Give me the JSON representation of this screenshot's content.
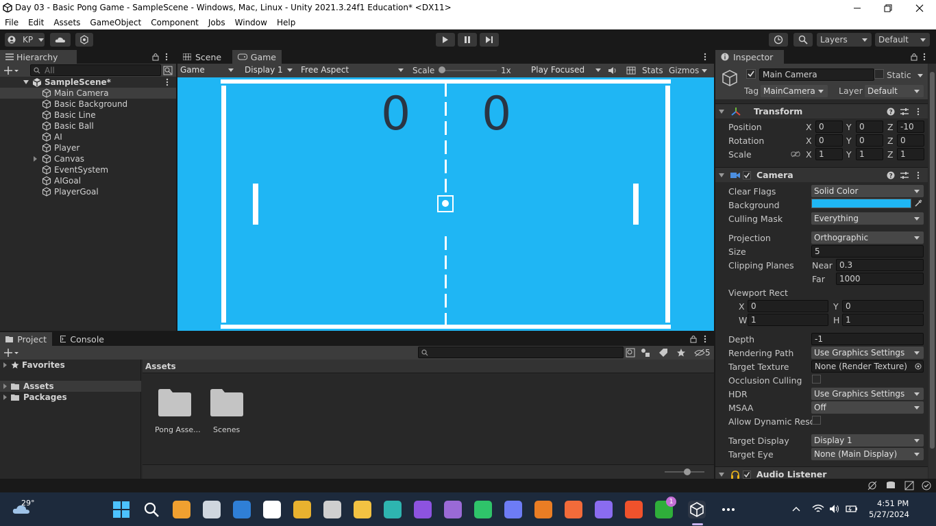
{
  "window": {
    "title": "Day 03 - Basic Pong Game - SampleScene - Windows, Mac, Linux - Unity 2021.3.24f1 Education* <DX11>"
  },
  "menu": [
    "File",
    "Edit",
    "Assets",
    "GameObject",
    "Component",
    "Jobs",
    "Window",
    "Help"
  ],
  "toolbar": {
    "account": "KP",
    "layers": "Layers",
    "layout": "Default"
  },
  "hierarchy": {
    "tab": "Hierarchy",
    "search_placeholder": "All",
    "scene": "SampleScene*",
    "items": [
      "Main Camera",
      "Basic Background",
      "Basic Line",
      "Basic Ball",
      "AI",
      "Player",
      "Canvas",
      "EventSystem",
      "AIGoal",
      "PlayerGoal"
    ]
  },
  "center": {
    "tabs": [
      "Scene",
      "Game"
    ],
    "game_toolbar": {
      "mode": "Game",
      "display": "Display 1",
      "aspect": "Free Aspect",
      "scale_label": "Scale",
      "scale_value": "1x",
      "play_focused": "Play Focused",
      "stats": "Stats",
      "gizmos": "Gizmos"
    },
    "scores": {
      "left": "0",
      "right": "0"
    }
  },
  "project": {
    "tabs": [
      "Project",
      "Console"
    ],
    "tree": [
      "Favorites",
      "Assets",
      "Packages"
    ],
    "breadcrumb": "Assets",
    "folders": [
      "Pong Asse...",
      "Scenes"
    ],
    "hidden_count": "5"
  },
  "inspector": {
    "tab": "Inspector",
    "object_name": "Main Camera",
    "static_label": "Static",
    "tag_label": "Tag",
    "tag_value": "MainCamera",
    "layer_label": "Layer",
    "layer_value": "Default",
    "transform": {
      "title": "Transform",
      "position": {
        "label": "Position",
        "x": "0",
        "y": "0",
        "z": "-10"
      },
      "rotation": {
        "label": "Rotation",
        "x": "0",
        "y": "0",
        "z": "0"
      },
      "scale": {
        "label": "Scale",
        "x": "1",
        "y": "1",
        "z": "1"
      }
    },
    "camera": {
      "title": "Camera",
      "clear_flags": {
        "label": "Clear Flags",
        "value": "Solid Color"
      },
      "background": {
        "label": "Background",
        "color": "#1fb6f4"
      },
      "culling_mask": {
        "label": "Culling Mask",
        "value": "Everything"
      },
      "projection": {
        "label": "Projection",
        "value": "Orthographic"
      },
      "size": {
        "label": "Size",
        "value": "5"
      },
      "clipping": {
        "label": "Clipping Planes",
        "near_label": "Near",
        "near": "0.3",
        "far_label": "Far",
        "far": "1000"
      },
      "viewport": {
        "label": "Viewport Rect",
        "x": "0",
        "y": "0",
        "w": "1",
        "h": "1"
      },
      "depth": {
        "label": "Depth",
        "value": "-1"
      },
      "rendering_path": {
        "label": "Rendering Path",
        "value": "Use Graphics Settings"
      },
      "target_texture": {
        "label": "Target Texture",
        "value": "None (Render Texture)"
      },
      "occlusion": {
        "label": "Occlusion Culling"
      },
      "hdr": {
        "label": "HDR",
        "value": "Use Graphics Settings"
      },
      "msaa": {
        "label": "MSAA",
        "value": "Off"
      },
      "dynamic_res": {
        "label": "Allow Dynamic Resol"
      },
      "target_display": {
        "label": "Target Display",
        "value": "Display 1"
      },
      "target_eye": {
        "label": "Target Eye",
        "value": "None (Main Display)"
      }
    },
    "audio_listener": {
      "title": "Audio Listener"
    }
  },
  "taskbar": {
    "temperature": "29°",
    "time": "4:51 PM",
    "date": "5/27/2024",
    "badge": "1"
  }
}
